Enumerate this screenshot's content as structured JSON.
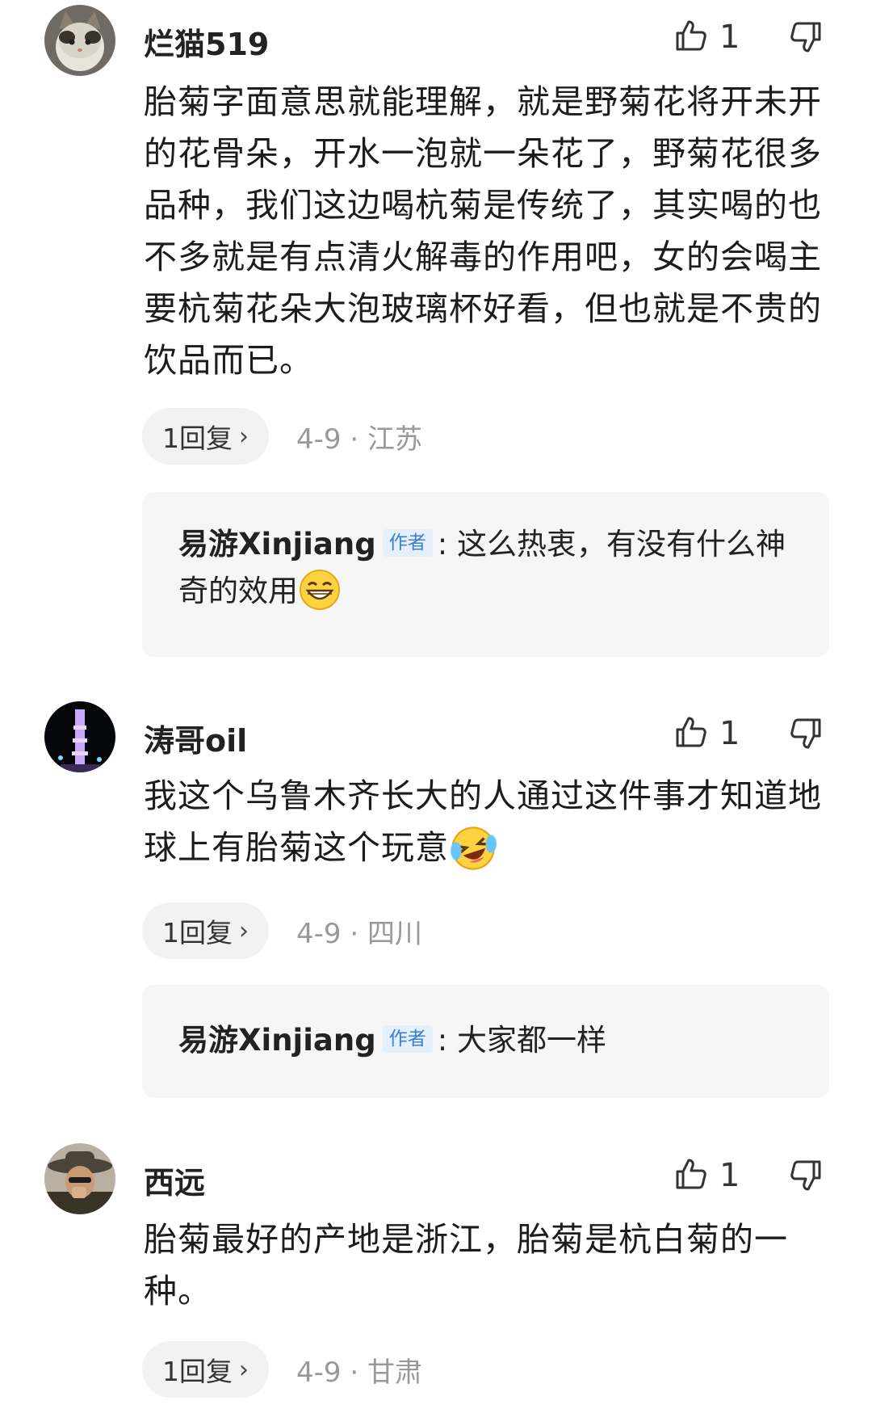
{
  "comments": [
    {
      "username": "烂猫519",
      "likes": "1",
      "text": "胎菊字面意思就能理解，就是野菊花将开未开的花骨朵，开水一泡就一朵花了，野菊花很多品种，我们这边喝杭菊是传统了，其实喝的也不多就是有点清火解毒的作用吧，女的会喝主要杭菊花朵大泡玻璃杯好看，但也就是不贵的饮品而已。",
      "reply_label": "1回复",
      "date": "4-9",
      "location": "江苏",
      "reply": {
        "author": "易游Xinjiang",
        "author_tag": "作者",
        "text": ": 这么热衷，有没有什么神奇的效用",
        "emoji": "grin-emoji"
      }
    },
    {
      "username": "涛哥oil",
      "likes": "1",
      "text": "我这个乌鲁木齐长大的人通过这件事才知道地球上有胎菊这个玩意",
      "text_emoji": "laugh-cry-emoji",
      "reply_label": "1回复",
      "date": "4-9",
      "location": "四川",
      "reply": {
        "author": "易游Xinjiang",
        "author_tag": "作者",
        "text": ": 大家都一样"
      }
    },
    {
      "username": "西远",
      "likes": "1",
      "text": "胎菊最好的产地是浙江，胎菊是杭白菊的一种。",
      "reply_label": "1回复",
      "date": "4-9",
      "location": "甘肃"
    }
  ],
  "meta_separator": " · ",
  "chevron": "›"
}
